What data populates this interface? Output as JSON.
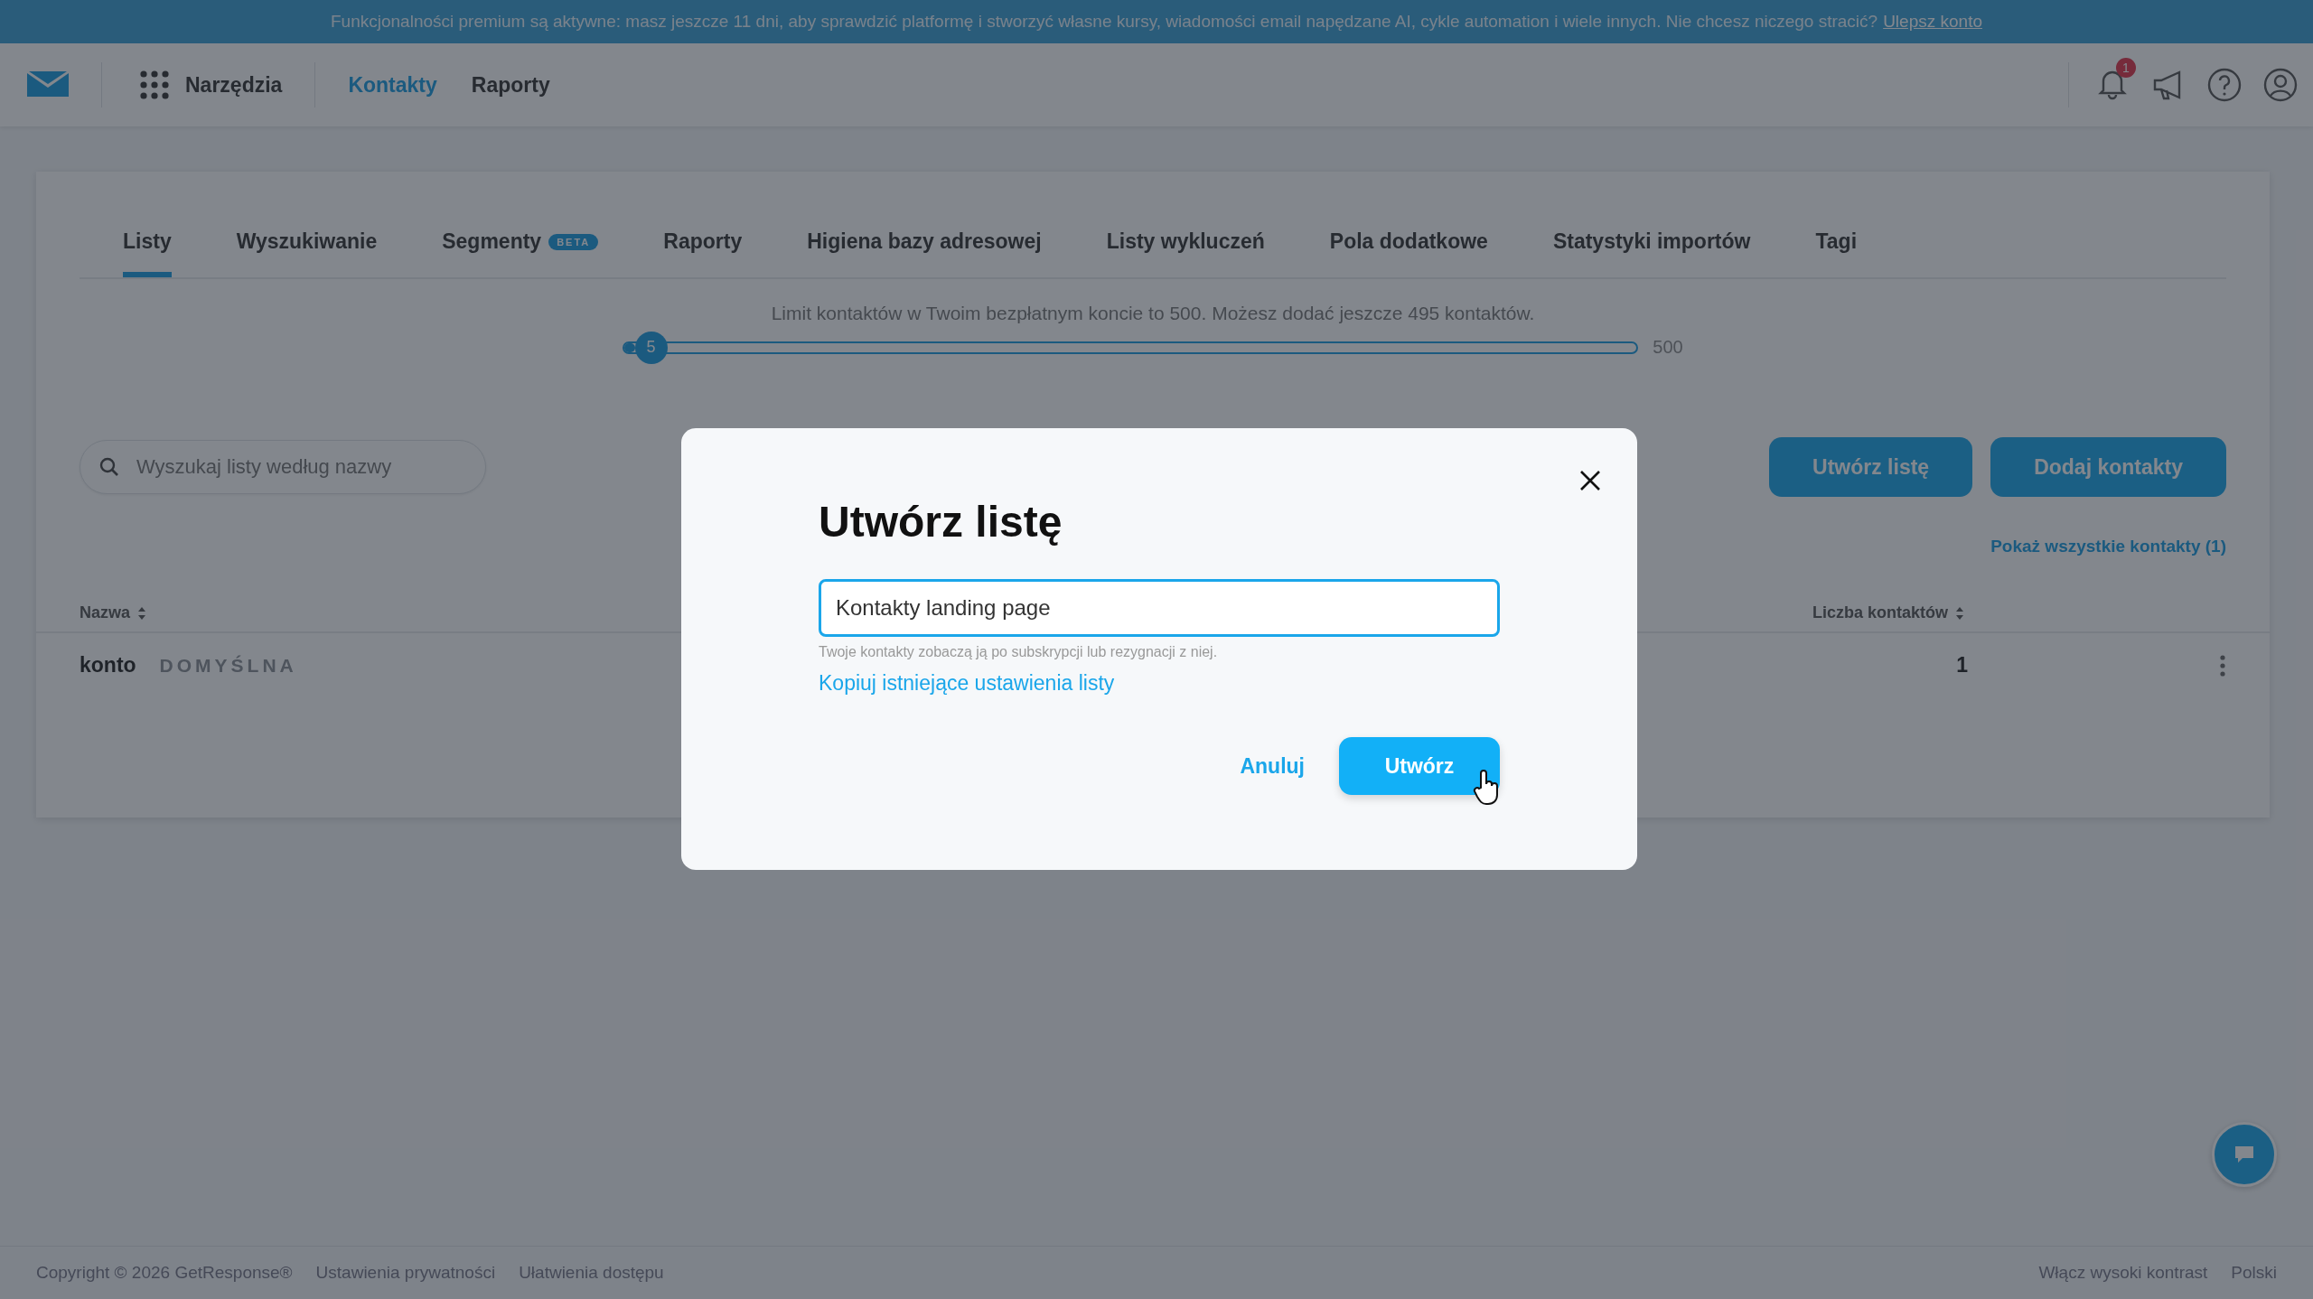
{
  "banner": {
    "text": "Funkcjonalności premium są aktywne: masz jeszcze 11 dni, aby sprawdzić platformę i stworzyć własne kursy, wiadomości email napędzane AI, cykle automation i wiele innych. Nie chcesz niczego stracić?",
    "link": "Ulepsz konto"
  },
  "nav": {
    "tools": "Narzędzia",
    "links": [
      {
        "label": "Kontakty",
        "selected": true
      },
      {
        "label": "Raporty",
        "selected": false
      }
    ],
    "notification_count": "1"
  },
  "tabs": [
    {
      "label": "Listy",
      "selected": true
    },
    {
      "label": "Wyszukiwanie",
      "selected": false
    },
    {
      "label": "Segmenty",
      "selected": false,
      "badge": "BETA"
    },
    {
      "label": "Raporty",
      "selected": false
    },
    {
      "label": "Higiena bazy adresowej",
      "selected": false
    },
    {
      "label": "Listy wykluczeń",
      "selected": false
    },
    {
      "label": "Pola dodatkowe",
      "selected": false
    },
    {
      "label": "Statystyki importów",
      "selected": false
    },
    {
      "label": "Tagi",
      "selected": false
    }
  ],
  "limit": {
    "text": "Limit kontaktów w Twoim bezpłatnym koncie to 500. Możesz dodać jeszcze 495 kontaktów.",
    "level": 0.01,
    "value": "5",
    "max": "500"
  },
  "search": {
    "placeholder": "Wyszukaj listy według nazwy"
  },
  "buttons": [
    "Utwórz listę",
    "Dodaj kontakty"
  ],
  "show_all_link": "Pokaż wszystkie kontakty (1)",
  "table": {
    "columns": [
      "Nazwa",
      "Liczba kontaktów"
    ],
    "rows": [
      {
        "name": "konto",
        "tag": "DOMYŚLNA",
        "count": "1"
      }
    ]
  },
  "modal": {
    "title": "Utwórz listę",
    "input_value": "Kontakty landing page",
    "helper": "Twoje kontakty zobaczą ją po subskrypcji lub rezygnacji z niej.",
    "copy_link": "Kopiuj istniejące ustawienia listy",
    "cancel": "Anuluj",
    "submit": "Utwórz"
  },
  "footer": {
    "left": [
      "Copyright © 2026 GetResponse®",
      "Ustawienia prywatności",
      "Ułatwienia dostępu"
    ],
    "right": [
      "Włącz wysoki kontrast",
      "Polski"
    ]
  }
}
